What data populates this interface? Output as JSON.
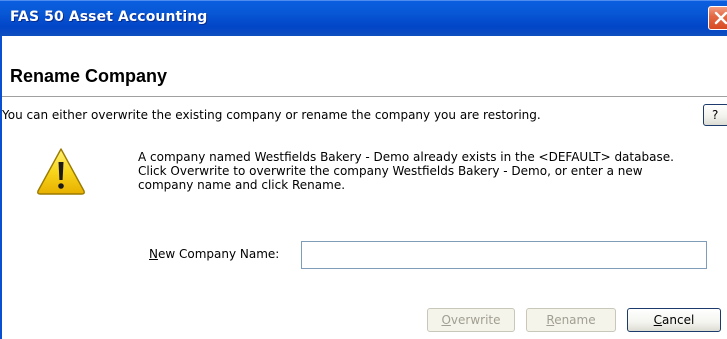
{
  "window": {
    "title": "FAS 50 Asset Accounting",
    "close_icon": "close-icon"
  },
  "header": {
    "title": "Rename Company"
  },
  "intro": {
    "text": "You can either overwrite the existing company or rename the company you are restoring.",
    "help_label": "?"
  },
  "warning": {
    "icon": "warning-icon",
    "lines": [
      "A company named Westfields Bakery - Demo already exists in the <DEFAULT> database.",
      "Click Overwrite to overwrite the company Westfields Bakery - Demo, or enter a new",
      "company name and click Rename."
    ]
  },
  "form": {
    "label_mnemonic": "N",
    "label_rest": "ew Company Name:",
    "value": ""
  },
  "buttons": {
    "overwrite": {
      "mnemonic": "O",
      "rest": "verwrite",
      "enabled": false
    },
    "rename": {
      "mnemonic": "R",
      "rest": "ename",
      "enabled": false
    },
    "cancel": {
      "mnemonic": "C",
      "rest": "ancel",
      "enabled": true
    }
  },
  "colors": {
    "titlebar": "#0858d6",
    "close_button": "#e36a45",
    "input_border": "#7f9db9"
  }
}
